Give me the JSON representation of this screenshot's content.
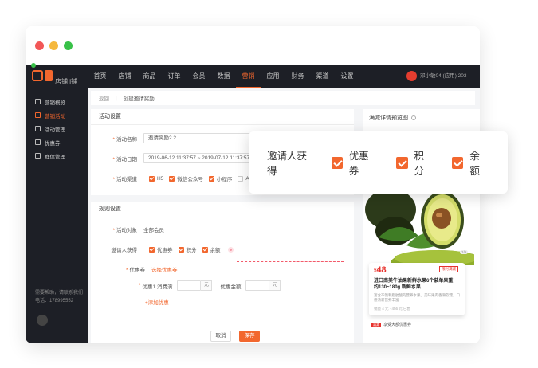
{
  "window": {
    "title": ""
  },
  "topnav": {
    "shop_name": "店铺 i铺",
    "items": [
      "首页",
      "店铺",
      "商品",
      "订单",
      "会员",
      "数据",
      "营销",
      "应用",
      "财务",
      "渠道",
      "设置"
    ],
    "active_index": 6,
    "user": "邓小敏04 (应用) 203",
    "accent": "#f2672e"
  },
  "sidebar": {
    "items": [
      {
        "label": "营销概览",
        "icon": "overview-icon"
      },
      {
        "label": "营销活动",
        "icon": "campaign-icon"
      },
      {
        "label": "活动管理",
        "icon": "manage-icon"
      },
      {
        "label": "优惠券",
        "icon": "coupon-icon"
      },
      {
        "label": "群体管理",
        "icon": "group-icon"
      }
    ],
    "active_index": 1,
    "help_line1": "需要帮助，请联系我们",
    "help_line2": "电话：178995552"
  },
  "breadcrumb": {
    "back": "返回",
    "current": "创建邀请奖励"
  },
  "form": {
    "activity_settings_title": "活动设置",
    "name_label": "活动名称",
    "name_value": "邀请奖励2.2",
    "date_label": "活动日期",
    "date_value": "2019-06-12 11:37:57 ~ 2019-07-12 11:37:57",
    "channel_label": "活动渠道",
    "channels": [
      "H5",
      "微信公众号",
      "小程序",
      "A"
    ],
    "rule_settings_title": "规则设置",
    "target_label": "活动对象",
    "target_value": "全部会员",
    "reward_label": "邀请人获得",
    "rewards": [
      "优惠券",
      "积分",
      "余额"
    ],
    "coupon_label": "优惠券",
    "coupon_select": "选择优惠券",
    "discount_label": "优惠1 消费满",
    "unit_yuan": "元",
    "discount_amount_label": "优惠金额",
    "add_discount": "+添加优惠",
    "cancel": "取消",
    "save": "保存"
  },
  "preview": {
    "title": "满减详情预览图",
    "product": {
      "price_symbol": "¥",
      "price": "48",
      "tag": "限时满减",
      "name": "进口南美牛油果新鲜水果6个装单果重约130~180g 新鲜水果",
      "desc": "富含不饱和脂肪酸的营养水果，美味果肉香滑软糯，口感清新营养丰富",
      "meta": "销量 4 元 · 456 元  已售"
    },
    "ticket_tag": "满减",
    "ticket_text": "享受大额优惠券"
  },
  "popup": {
    "label": "邀请人获得",
    "options": [
      "优惠券",
      "积分",
      "余额"
    ]
  }
}
